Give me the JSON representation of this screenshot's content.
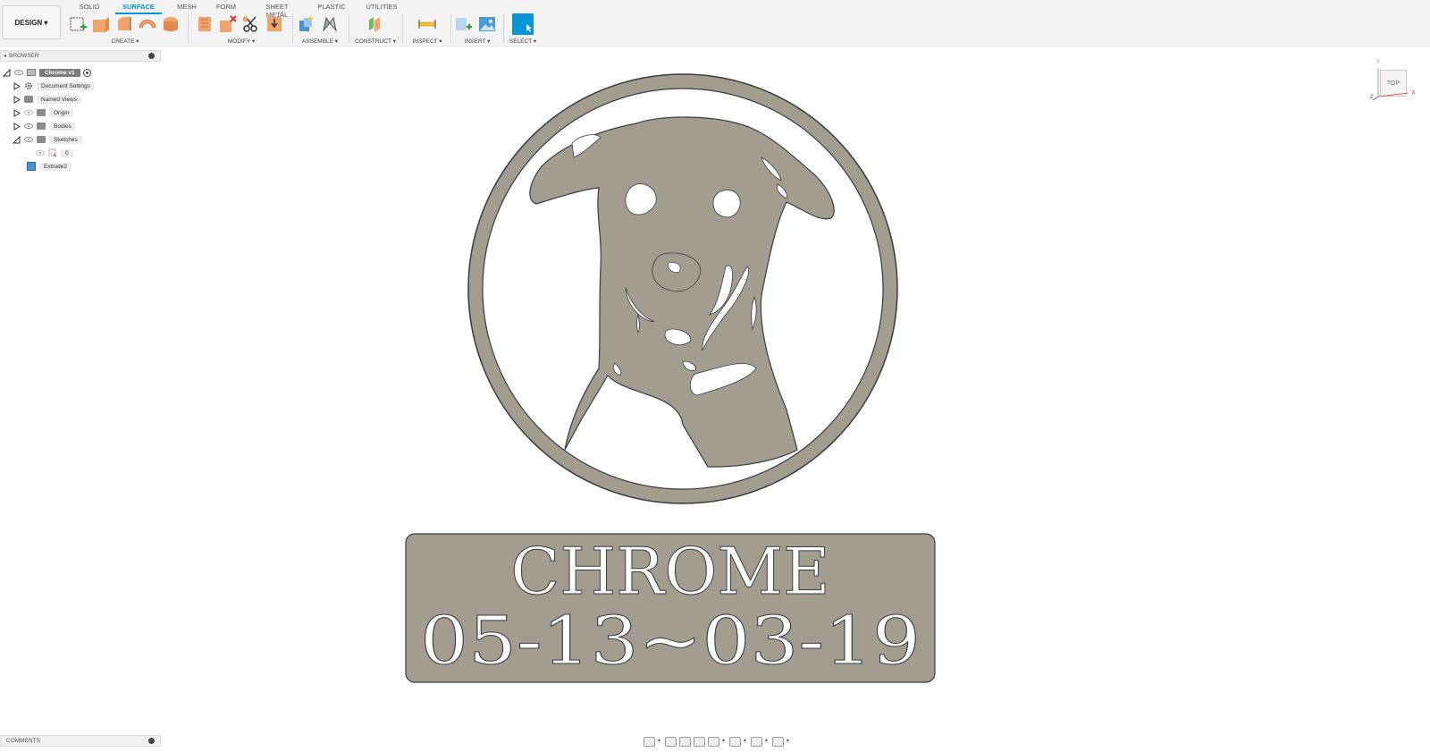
{
  "toolbar": {
    "workspace": "DESIGN ▾",
    "tabs": [
      "SOLID",
      "SURFACE",
      "MESH",
      "FORM",
      "SHEET METAL",
      "PLASTIC",
      "UTILITIES"
    ],
    "active_tab": "SURFACE",
    "groups": {
      "create": "CREATE ▾",
      "modify": "MODIFY ▾",
      "assemble": "ASSEMBLE ▾",
      "construct": "CONSTRUCT ▾",
      "inspect": "INSPECT ▾",
      "insert": "INSERT ▾",
      "select": "SELECT ▾"
    },
    "accent_color": "#0696d7",
    "surface_icon_color": "#f0a36a"
  },
  "browser": {
    "title": "BROWSER",
    "root": "Chrome v1",
    "items": {
      "document_settings": "Document Settings",
      "named_views": "Named Views",
      "origin": "Origin",
      "bodies": "Bodies",
      "sketches": "Sketches",
      "sketch_0": "0",
      "extrude": "Extrude2"
    }
  },
  "comments": {
    "title": "COMMENTS"
  },
  "viewport": {
    "viewcube_face": "TOP",
    "axis_x": "X",
    "axis_y": "Y",
    "axis_z": "Z",
    "model_color": "#a39d90",
    "plaque_line1": "CHROME",
    "plaque_line2": "05-13~03-19"
  }
}
